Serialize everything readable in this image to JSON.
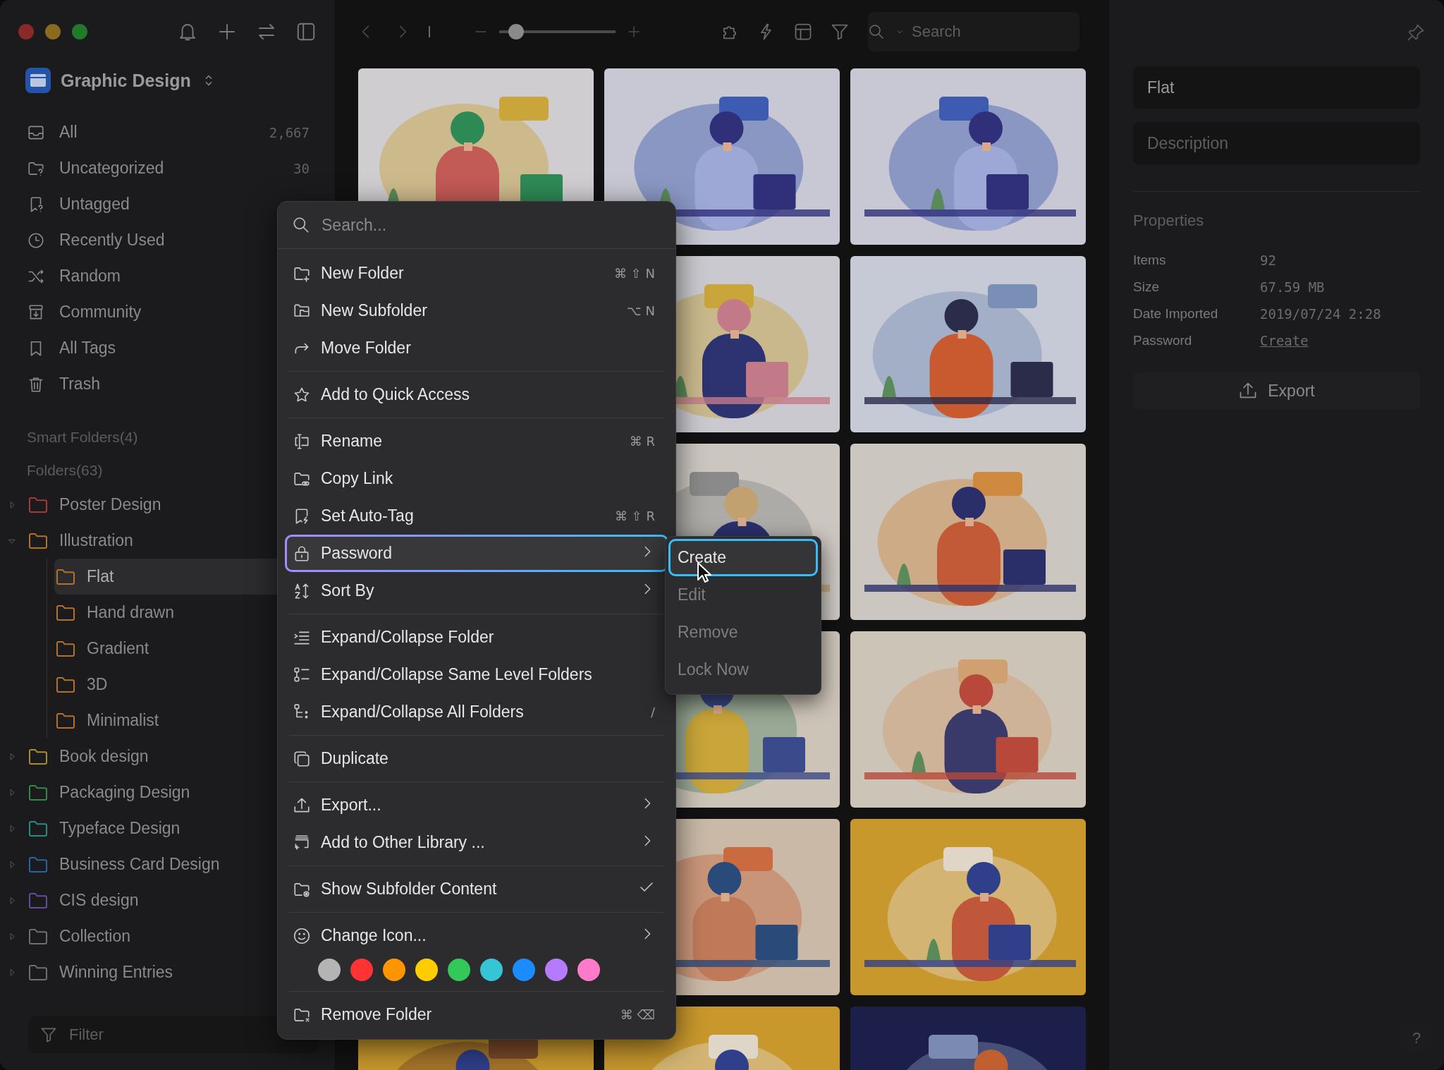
{
  "titlebar": {
    "library": "Graphic Design"
  },
  "nav": [
    {
      "label": "All",
      "count": "2,667"
    },
    {
      "label": "Uncategorized",
      "count": "30"
    },
    {
      "label": "Untagged"
    },
    {
      "label": "Recently Used"
    },
    {
      "label": "Random"
    },
    {
      "label": "Community"
    },
    {
      "label": "All Tags"
    },
    {
      "label": "Trash"
    }
  ],
  "smart_folders": "Smart Folders(4)",
  "folders_heading": "Folders(63)",
  "folders": [
    {
      "label": "Poster Design",
      "color": "#a53a36",
      "expanded": false,
      "selected": false
    },
    {
      "label": "Illustration",
      "color": "#b3702a",
      "expanded": true,
      "selected": false,
      "children": [
        {
          "label": "Flat",
          "color": "#b3702a",
          "selected": true
        },
        {
          "label": "Hand drawn",
          "color": "#b3702a",
          "selected": false
        },
        {
          "label": "Gradient",
          "color": "#b3702a",
          "selected": false
        },
        {
          "label": "3D",
          "color": "#b3702a",
          "selected": false
        },
        {
          "label": "Minimalist",
          "color": "#b3702a",
          "selected": false
        }
      ]
    },
    {
      "label": "Book design",
      "color": "#a98d2c",
      "expanded": false,
      "selected": false
    },
    {
      "label": "Packaging Design",
      "color": "#2f8a4a",
      "expanded": false,
      "selected": false
    },
    {
      "label": "Typeface Design",
      "color": "#2a8a8a",
      "expanded": false,
      "selected": false
    },
    {
      "label": "Business Card Design",
      "color": "#2a64a8",
      "expanded": false,
      "selected": false
    },
    {
      "label": "CIS design",
      "color": "#6a4aa0",
      "expanded": false,
      "selected": false
    },
    {
      "label": "Collection",
      "color": "#6e6e6e",
      "expanded": false,
      "selected": false
    },
    {
      "label": "Winning Entries",
      "color": "#6e6e6e",
      "expanded": false,
      "selected": false
    }
  ],
  "filter": {
    "placeholder": "Filter"
  },
  "toolbar": {
    "zoom": {
      "level": 0.13
    },
    "search": {
      "placeholder": "Search"
    }
  },
  "inspector": {
    "name": "Flat",
    "description": {
      "placeholder": "Description"
    },
    "properties_heading": "Properties",
    "properties": [
      {
        "kind": "text",
        "label": "Items",
        "value": "92"
      },
      {
        "kind": "text",
        "label": "Size",
        "value": "67.59 MB"
      },
      {
        "kind": "text",
        "label": "Date Imported",
        "value": "2019/07/24 2:28"
      },
      {
        "kind": "link",
        "label": "Password",
        "value": "Create"
      }
    ],
    "export": "Export",
    "help": "?"
  },
  "menu": {
    "search": {
      "placeholder": "Search..."
    },
    "entries": [
      {
        "kind": "item",
        "label": "New Folder",
        "shortcut": "⌘ ⇧ N",
        "has_submenu": false,
        "checked": false,
        "selected": false
      },
      {
        "kind": "item",
        "label": "New Subfolder",
        "shortcut": "⌥ N",
        "has_submenu": false,
        "checked": false,
        "selected": false
      },
      {
        "kind": "item",
        "label": "Move Folder",
        "has_submenu": false,
        "checked": false,
        "selected": false
      },
      {
        "kind": "separator"
      },
      {
        "kind": "item",
        "label": "Add to Quick Access",
        "has_submenu": false,
        "checked": false,
        "selected": false
      },
      {
        "kind": "separator"
      },
      {
        "kind": "item",
        "label": "Rename",
        "shortcut": "⌘ R",
        "has_submenu": false,
        "checked": false,
        "selected": false
      },
      {
        "kind": "item",
        "label": "Copy Link",
        "has_submenu": false,
        "checked": false,
        "selected": false
      },
      {
        "kind": "item",
        "label": "Set Auto-Tag",
        "shortcut": "⌘ ⇧ R",
        "has_submenu": false,
        "checked": false,
        "selected": false
      },
      {
        "kind": "item",
        "label": "Password",
        "has_submenu": true,
        "checked": false,
        "selected": true
      },
      {
        "kind": "item",
        "label": "Sort By",
        "has_submenu": true,
        "checked": false,
        "selected": false
      },
      {
        "kind": "separator"
      },
      {
        "kind": "item",
        "label": "Expand/Collapse Folder",
        "has_submenu": false,
        "checked": false,
        "selected": false
      },
      {
        "kind": "item",
        "label": "Expand/Collapse Same Level Folders",
        "has_submenu": false,
        "checked": false,
        "selected": false
      },
      {
        "kind": "item",
        "label": "Expand/Collapse All Folders",
        "shortcut": "/",
        "has_submenu": false,
        "checked": false,
        "selected": false
      },
      {
        "kind": "separator"
      },
      {
        "kind": "item",
        "label": "Duplicate",
        "has_submenu": false,
        "checked": false,
        "selected": false
      },
      {
        "kind": "separator"
      },
      {
        "kind": "item",
        "label": "Export...",
        "has_submenu": true,
        "checked": false,
        "selected": false
      },
      {
        "kind": "item",
        "label": "Add to Other Library ...",
        "has_submenu": true,
        "checked": false,
        "selected": false
      },
      {
        "kind": "separator"
      },
      {
        "kind": "item",
        "label": "Show Subfolder Content",
        "has_submenu": false,
        "checked": true,
        "selected": false
      },
      {
        "kind": "separator"
      },
      {
        "kind": "item",
        "label": "Change Icon...",
        "has_submenu": true,
        "checked": false,
        "selected": false
      },
      {
        "kind": "colors",
        "swatches": [
          {
            "color": "#b4b4b4"
          },
          {
            "color": "#ff3333"
          },
          {
            "color": "#ff9500"
          },
          {
            "color": "#ffcc00"
          },
          {
            "color": "#34c759"
          },
          {
            "color": "#36c5d6"
          },
          {
            "color": "#1a8cff"
          },
          {
            "color": "#b57bff"
          },
          {
            "color": "#ff7ac8"
          }
        ]
      },
      {
        "kind": "separator"
      },
      {
        "kind": "item",
        "label": "Remove Folder",
        "shortcut": "⌘ ⌫",
        "has_submenu": false,
        "checked": false,
        "selected": false
      }
    ]
  },
  "submenu": [
    {
      "label": "Create",
      "selected": true,
      "disabled": false
    },
    {
      "label": "Edit",
      "selected": false,
      "disabled": true
    },
    {
      "label": "Remove",
      "selected": false,
      "disabled": true
    },
    {
      "label": "Lock Now",
      "selected": false,
      "disabled": true
    }
  ]
}
